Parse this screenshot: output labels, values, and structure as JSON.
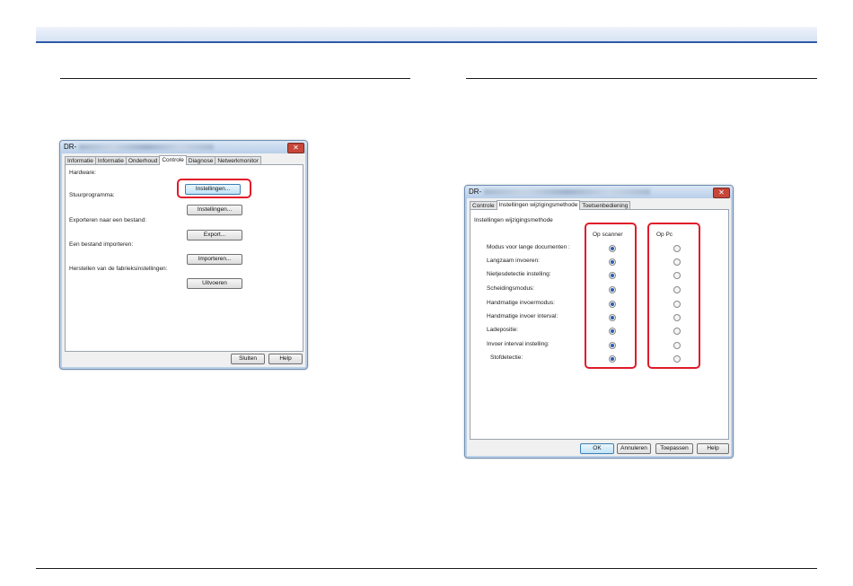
{
  "left_dialog": {
    "title_prefix": "DR-",
    "close_glyph": "✕",
    "tabs": [
      "Informatie",
      "Informatie",
      "Onderhoud",
      "Controle",
      "Diagnose",
      "Netwerkmonitor"
    ],
    "sections": [
      {
        "label": "Hardware:",
        "button": "Instellingen..."
      },
      {
        "label": "Stuurprogramma:",
        "button": "Instellingen..."
      },
      {
        "label": "Exporteren naar een bestand:",
        "button": "Export..."
      },
      {
        "label": "Een bestand importeren:",
        "button": "Importeren..."
      },
      {
        "label": "Herstellen van de fabrieksinstellingen:",
        "button": "Uitvoeren"
      }
    ],
    "close_button": "Sluiten",
    "help_button": "Help"
  },
  "right_dialog": {
    "title_prefix": "DR-",
    "close_glyph": "✕",
    "tabs": [
      "Controle",
      "Instellingen wijzigingsmethode",
      "Toetsenbediening"
    ],
    "group_title": "Instellingen wijzigingsmethode",
    "column_scanner": "Op scanner",
    "column_pc": "Op Pc",
    "rows": [
      {
        "label": "Modus voor lange documenten :",
        "scanner": true
      },
      {
        "label": "Langzaam invoeren:",
        "scanner": true
      },
      {
        "label": "Nietjesdetectie instelling:",
        "scanner": true
      },
      {
        "label": "Scheidingsmodus:",
        "scanner": true
      },
      {
        "label": "Handmatige invoermodus:",
        "scanner": true
      },
      {
        "label": "Handmatige invoer interval:",
        "scanner": true
      },
      {
        "label": "Ladepositie:",
        "scanner": true
      },
      {
        "label": "Invoer interval instelling:",
        "scanner": true
      },
      {
        "label": "Stofdetectie:",
        "scanner": true
      }
    ],
    "ok_button": "OK",
    "cancel_button": "Annuleren",
    "apply_button": "Toepassen",
    "help_button": "Help"
  },
  "colors": {
    "accent_line": "#2f5aa8",
    "highlight": "#e01a2a"
  }
}
